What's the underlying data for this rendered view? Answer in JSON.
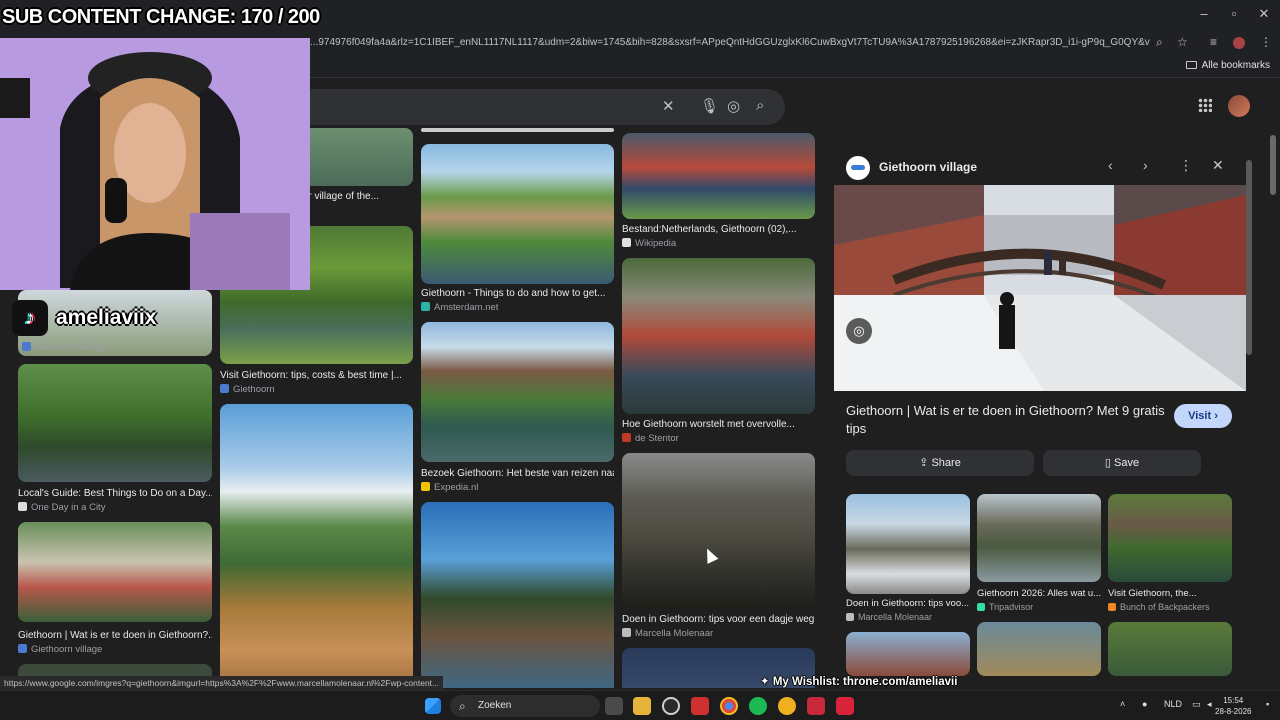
{
  "overlay": {
    "sub_counter": "SUB CONTENT CHANGE: 170 / 200",
    "tiktok_handle": "ameliaviix",
    "wishlist": "My Wishlist: throne.com/ameliavii"
  },
  "browser": {
    "url": "...974976f049fa4a&rlz=1C1IBEF_enNL1117NL1117&udm=2&biw=1745&bih=828&sxsrf=APpeQntHdGGUzglxKl6CuwBxgVt7TcTU9A%3A1787925196268&ei=zJKRapr3D_i1i-gP9q_G0QY&ved=0ahUKEwiajdWx...",
    "bookmarks_all": "Alle bookmarks"
  },
  "grid": {
    "col1": [
      {
        "caption": "Giethoorn | Wat is er te doen in Giethoorn?...",
        "source": "Giethoorn village",
        "fav": "#4a7bd0"
      },
      {
        "caption": "Local's Guide: Best Things to Do on a Day...",
        "source": "One Day in a City",
        "fav": "#dcdcdc"
      },
      {
        "caption": "Giethoorn | Wat is er te doen in Giethoorn?...",
        "source": "Giethoorn village",
        "fav": "#4a7bd0"
      }
    ],
    "col2": [
      {
        "caption": "...r village of the..."
      },
      {
        "caption": "Visit Giethoorn: tips, costs & best time |...",
        "source": "Giethoorn",
        "fav": "#4a7bd0"
      }
    ],
    "col3": [
      {
        "caption": "Giethoorn - Things to do and how to get...",
        "source": "Amsterdam.net",
        "fav": "#2ab3a8"
      },
      {
        "caption": "Bezoek Giethoorn: Het beste van reizen naa...",
        "source": "Expedia.nl",
        "fav": "#f3c400"
      }
    ],
    "col4": [
      {
        "caption": "Bestand:Netherlands, Giethoorn (02),...",
        "source": "Wikipedia",
        "fav": "#e0e0e0"
      },
      {
        "caption": "Hoe Giethoorn worstelt met overvolle...",
        "source": "de Stentor",
        "fav": "#c0392b"
      },
      {
        "caption": "Doen in Giethoorn: tips voor een dagje weg -",
        "source": "Marcella Molenaar",
        "fav": "#bdbdbd"
      }
    ]
  },
  "panel": {
    "site": "Giethoorn village",
    "headline": "Giethoorn | Wat is er te doen in Giethoorn? Met 9 gratis tips",
    "visit": "Visit",
    "share": "Share",
    "save": "Save",
    "related": [
      {
        "caption": "Doen in Giethoorn: tips voo...",
        "source": "Marcella Molenaar",
        "fav": "#bdbdbd"
      },
      {
        "caption": "Giethoorn 2026: Alles wat u...",
        "source": "Tripadvisor",
        "fav": "#34e0a1"
      },
      {
        "caption": "Visit Giethoorn, the...",
        "source": "Bunch of Backpackers",
        "fav": "#f08a24"
      }
    ]
  },
  "statusbar": {
    "link": "https://www.google.com/imgres?q=giethoorn&imgurl=https%3A%2F%2Fwww.marcellamolenaar.nl%2Fwp-content..."
  },
  "taskbar": {
    "search": "Zoeken",
    "lang": "NLD",
    "time": "15:54",
    "date": "28-8-2026"
  }
}
